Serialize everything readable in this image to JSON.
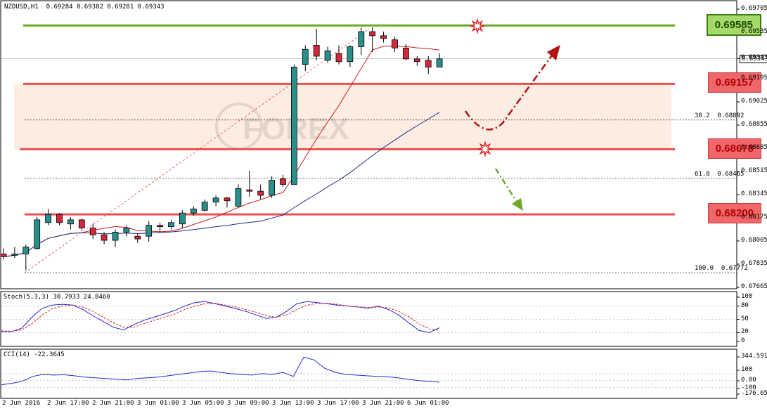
{
  "header": {
    "symbol": "NZDUSD,H1",
    "ohlc": "0.69284 0.69382 0.69281 0.69343"
  },
  "current_price_tag": "0.69343",
  "levels": [
    {
      "value": "0.69585",
      "kind": "resistance",
      "color": "#6aa92a"
    },
    {
      "value": "0.69157",
      "kind": "level",
      "color": "#e8524f"
    },
    {
      "value": "0.68678",
      "kind": "level",
      "color": "#e8524f"
    },
    {
      "value": "0.68200",
      "kind": "support",
      "color": "#e8524f"
    }
  ],
  "fib_labels": [
    "38.2  0.68892",
    "61.8  0.68465",
    "100.0  0.67772"
  ],
  "watermark": "FOREX",
  "stoch_label": "Stoch(5,3,3) 30.7933 24.8460",
  "cci_label": "CCI(14) -22.3645",
  "price_axis": [
    "0.69705",
    "0.69535",
    "0.69343",
    "0.69195",
    "0.69025",
    "0.68855",
    "0.68685",
    "0.68515",
    "0.68345",
    "0.68175",
    "0.68005",
    "0.67835",
    "0.67665"
  ],
  "stoch_axis": [
    "100",
    "80",
    "50",
    "20",
    "0"
  ],
  "cci_axis": [
    "344.5911",
    "100",
    "0.00",
    "-100",
    "-176.653"
  ],
  "time_axis": [
    "2 Jun 2016",
    "2 Jun 17:00",
    "2 Jun 21:00",
    "3 Jun 01:00",
    "3 Jun 05:00",
    "3 Jun 09:00",
    "3 Jun 13:00",
    "3 Jun 17:00",
    "3 Jun 21:00",
    "6 Jun 01:00"
  ],
  "chart_data": {
    "type": "candlestick",
    "title": "NZDUSD,H1",
    "ylim": [
      0.67665,
      0.6973
    ],
    "candles": [
      [
        0.6791,
        0.6795,
        0.6787,
        0.6789
      ],
      [
        0.679,
        0.6796,
        0.6788,
        0.6791
      ],
      [
        0.6791,
        0.6798,
        0.6779,
        0.6796
      ],
      [
        0.6795,
        0.6818,
        0.6794,
        0.6816
      ],
      [
        0.6814,
        0.6824,
        0.6812,
        0.682
      ],
      [
        0.682,
        0.6821,
        0.6812,
        0.6814
      ],
      [
        0.6813,
        0.6818,
        0.6809,
        0.6816
      ],
      [
        0.6816,
        0.6817,
        0.6808,
        0.681
      ],
      [
        0.681,
        0.6813,
        0.6802,
        0.6805
      ],
      [
        0.6805,
        0.6807,
        0.6798,
        0.6801
      ],
      [
        0.6801,
        0.6809,
        0.6796,
        0.6807
      ],
      [
        0.6807,
        0.6812,
        0.6804,
        0.681
      ],
      [
        0.6804,
        0.6806,
        0.6799,
        0.6802
      ],
      [
        0.6804,
        0.6815,
        0.68,
        0.6812
      ],
      [
        0.6812,
        0.6814,
        0.6807,
        0.6811
      ],
      [
        0.6811,
        0.6816,
        0.6809,
        0.6814
      ],
      [
        0.6813,
        0.6823,
        0.681,
        0.6821
      ],
      [
        0.6821,
        0.6826,
        0.6819,
        0.6824
      ],
      [
        0.6823,
        0.6831,
        0.6822,
        0.6829
      ],
      [
        0.6829,
        0.6834,
        0.6826,
        0.6832
      ],
      [
        0.6832,
        0.6833,
        0.6825,
        0.683
      ],
      [
        0.6826,
        0.6842,
        0.6825,
        0.6839
      ],
      [
        0.6838,
        0.6852,
        0.6833,
        0.6837
      ],
      [
        0.6837,
        0.6842,
        0.6831,
        0.6834
      ],
      [
        0.6834,
        0.6848,
        0.6832,
        0.6845
      ],
      [
        0.6846,
        0.6849,
        0.684,
        0.6842
      ],
      [
        0.6842,
        0.693,
        0.6842,
        0.6928
      ],
      [
        0.693,
        0.6944,
        0.6925,
        0.6941
      ],
      [
        0.6944,
        0.6956,
        0.6933,
        0.6936
      ],
      [
        0.6933,
        0.6943,
        0.6931,
        0.694
      ],
      [
        0.6938,
        0.6944,
        0.693,
        0.6932
      ],
      [
        0.6932,
        0.6944,
        0.6928,
        0.6943
      ],
      [
        0.6943,
        0.6957,
        0.6937,
        0.6954
      ],
      [
        0.6954,
        0.6957,
        0.6939,
        0.6951
      ],
      [
        0.6951,
        0.6954,
        0.6946,
        0.6949
      ],
      [
        0.6948,
        0.695,
        0.6939,
        0.6942
      ],
      [
        0.6942,
        0.6945,
        0.6933,
        0.6934
      ],
      [
        0.6934,
        0.6936,
        0.6929,
        0.6932
      ],
      [
        0.6933,
        0.6936,
        0.6923,
        0.6928
      ],
      [
        0.6928,
        0.6938,
        0.6928,
        0.6934
      ]
    ],
    "stoch_k": [
      22,
      22,
      30,
      55,
      75,
      82,
      84,
      82,
      72,
      58,
      45,
      32,
      26,
      38,
      48,
      55,
      62,
      70,
      80,
      88,
      90,
      85,
      80,
      74,
      68,
      60,
      52,
      55,
      68,
      85,
      90,
      88,
      85,
      82,
      80,
      78,
      75,
      80,
      72,
      60,
      42,
      25,
      20,
      31
    ],
    "stoch_d": [
      24,
      23,
      26,
      40,
      60,
      74,
      80,
      82,
      78,
      68,
      55,
      42,
      32,
      32,
      40,
      48,
      55,
      62,
      72,
      80,
      85,
      86,
      82,
      78,
      72,
      66,
      58,
      55,
      60,
      72,
      82,
      86,
      86,
      84,
      80,
      78,
      77,
      78,
      76,
      68,
      56,
      40,
      28,
      25
    ],
    "cci": [
      -60,
      -40,
      -10,
      60,
      90,
      80,
      85,
      70,
      50,
      40,
      30,
      20,
      10,
      30,
      40,
      50,
      70,
      90,
      110,
      130,
      140,
      120,
      100,
      90,
      80,
      100,
      90,
      120,
      60,
      340,
      300,
      180,
      120,
      90,
      80,
      70,
      60,
      55,
      40,
      20,
      0,
      -10,
      -22
    ]
  }
}
